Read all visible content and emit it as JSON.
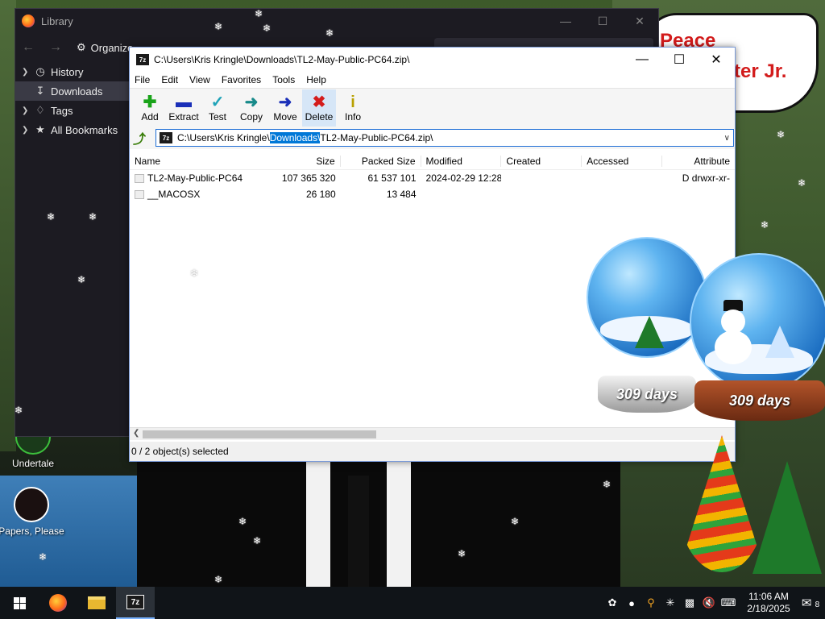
{
  "desktop": {
    "bubble": {
      "line1": "Peace",
      "line2": "ter Jr."
    },
    "icons": [
      {
        "label": "Undertale"
      },
      {
        "label": "Papers, Please"
      }
    ],
    "globe_small": {
      "label": "309 days"
    },
    "globe_big": {
      "label": "309 days"
    }
  },
  "library": {
    "title": "Library",
    "toolbar": {
      "organize_label": "Organize"
    },
    "sidebar": [
      {
        "label": "History"
      },
      {
        "label": "Downloads"
      },
      {
        "label": "Tags"
      },
      {
        "label": "All Bookmarks"
      }
    ]
  },
  "zip": {
    "title": "C:\\Users\\Kris Kringle\\Downloads\\TL2-May-Public-PC64.zip\\",
    "menu": [
      "File",
      "Edit",
      "View",
      "Favorites",
      "Tools",
      "Help"
    ],
    "toolbar": [
      {
        "label": "Add",
        "icon": "plus"
      },
      {
        "label": "Extract",
        "icon": "minus"
      },
      {
        "label": "Test",
        "icon": "check"
      },
      {
        "label": "Copy",
        "icon": "arrow-right"
      },
      {
        "label": "Move",
        "icon": "arrow-right-blue"
      },
      {
        "label": "Delete",
        "icon": "x"
      },
      {
        "label": "Info",
        "icon": "i"
      }
    ],
    "address": {
      "prefix": "C:\\Users\\Kris Kringle\\",
      "highlight": "Downloads\\",
      "suffix": "TL2-May-Public-PC64.zip\\"
    },
    "columns": [
      "Name",
      "Size",
      "Packed Size",
      "Modified",
      "Created",
      "Accessed",
      "Attribute"
    ],
    "rows": [
      {
        "name": "TL2-May-Public-PC64",
        "size": "107 365 320",
        "packed": "61 537 101",
        "modified": "2024-02-29 12:28",
        "created": "",
        "accessed": "",
        "attr": "D drwxr-xr-"
      },
      {
        "name": "__MACOSX",
        "size": "26 180",
        "packed": "13 484",
        "modified": "",
        "created": "",
        "accessed": "",
        "attr": ""
      }
    ],
    "status": "0 / 2 object(s) selected"
  },
  "taskbar": {
    "time": "11:06 AM",
    "date": "2/18/2025",
    "notification_count": "8"
  }
}
